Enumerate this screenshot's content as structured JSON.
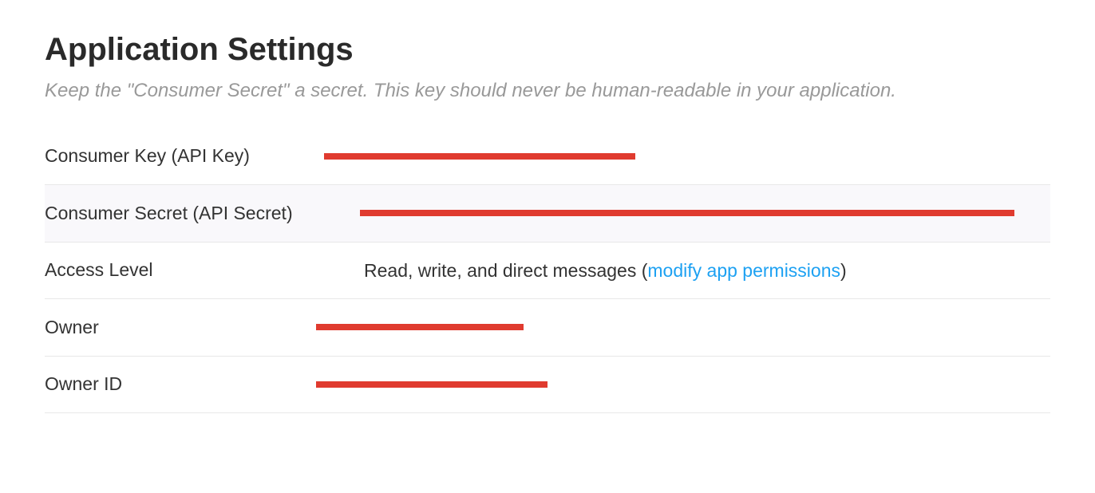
{
  "header": {
    "title": "Application Settings",
    "subtitle": "Keep the \"Consumer Secret\" a secret. This key should never be human-readable in your application."
  },
  "rows": {
    "consumer_key": {
      "label": "Consumer Key (API Key)"
    },
    "consumer_secret": {
      "label": "Consumer Secret (API Secret)"
    },
    "access_level": {
      "label": "Access Level",
      "value_prefix": "Read, write, and direct messages (",
      "link_text": "modify app permissions",
      "value_suffix": ")"
    },
    "owner": {
      "label": "Owner"
    },
    "owner_id": {
      "label": "Owner ID"
    }
  }
}
